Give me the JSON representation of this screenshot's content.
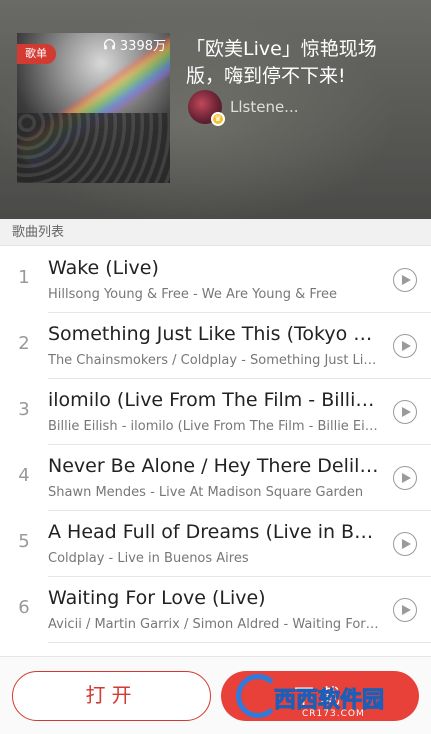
{
  "header": {
    "cover_tag": "歌单",
    "play_count": "3398万",
    "title": "「欧美Live」惊艳现场版，嗨到停不下来!",
    "creator_name": "Llstene..."
  },
  "section": {
    "label": "歌曲列表"
  },
  "songs": [
    {
      "num": "1",
      "name": "Wake (Live)",
      "artist": "Hillsong Young & Free - We Are Young & Free"
    },
    {
      "num": "2",
      "name": "Something Just Like This (Tokyo R...",
      "artist": "The Chainsmokers / Coldplay - Something Just Lik..."
    },
    {
      "num": "3",
      "name": "ilomilo (Live From The Film - Billie ...",
      "artist": "Billie Eilish - ilomilo (Live From The Film - Billie Eilis..."
    },
    {
      "num": "4",
      "name": "Never Be Alone / Hey There Delilah ...",
      "artist": "Shawn Mendes - Live At Madison Square Garden"
    },
    {
      "num": "5",
      "name": "A Head Full of Dreams (Live in Bue...",
      "artist": "Coldplay - Live in Buenos Aires"
    },
    {
      "num": "6",
      "name": "Waiting For Love (Live)",
      "artist": "Avicii / Martin Garrix / Simon Aldred - Waiting For ..."
    }
  ],
  "bottom": {
    "open_label": "打开",
    "download_label": "下载"
  },
  "watermark": {
    "text": "西西软件园",
    "sub": "CR173.COM"
  },
  "colors": {
    "accent": "#d33a31",
    "download": "#e8413a"
  }
}
